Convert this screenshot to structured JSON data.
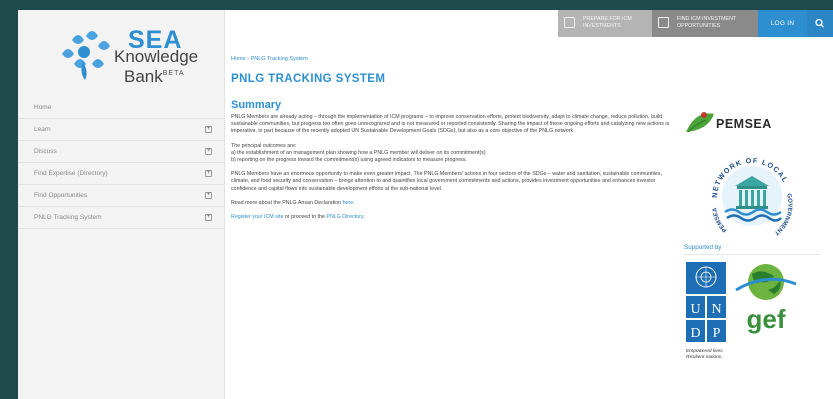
{
  "brand": {
    "sea": "SEA",
    "knowledge": "Knowledge",
    "bank": "Bank",
    "beta": "BETA"
  },
  "topbar": {
    "prepare_label": "PREPARE FOR ICM INVESTMENTS",
    "find_label": "FIND ICM INVESTMENT OPPORTUNITIES",
    "login_label": "LOG IN",
    "search_glyph": "🔍"
  },
  "nav": {
    "items": [
      {
        "label": "Home",
        "expandable": false
      },
      {
        "label": "Learn",
        "expandable": true
      },
      {
        "label": "Discuss",
        "expandable": true
      },
      {
        "label": "Find Expertise (Directory)",
        "expandable": true
      },
      {
        "label": "Find Opportunities",
        "expandable": true
      },
      {
        "label": "PNLG Tracking System",
        "expandable": true
      }
    ]
  },
  "breadcrumb": {
    "home": "Home",
    "separator": "›",
    "current": "PNLG Tracking System"
  },
  "main": {
    "title": "PNLG TRACKING SYSTEM",
    "summary_heading": "Summary",
    "p1": "PNLG Members are already acting – through the implementation of ICM programs – to improve conservation efforts, protect biodiversity, adapt to climate change, reduce pollution, build sustainable communities, but progress too often goes unrecognized and is not measured or reported consistently. Sharing the impact of these ongoing efforts and catalyzing new actions is imperative, in part because of the recently adopted UN Sustainable Development Goals (SDGs), but also as a core objective of the PNLG network.",
    "outcomes_intro": "The principal outcomes are:",
    "outcome_a": "a) the establishment of an management plan showing how a PNLG member will deliver on its commitment(s)",
    "outcome_b": "b) reporting on the progress toward the commitment(s) using agreed indicators to measure progress.",
    "p3": "PNLG Members have an enormous opportunity to make even greater impact. The PNLG Members' actions in four sectors of the SDGs – water and sanitation, sustainable communities, climate, and food security and conservation – brings attention to and quantifies local government commitments and actions, provides investment opportunities and enhances investor confidence and capital flows into sustainable development efforts at the sub-national level.",
    "read_more_prefix": "Read more about the PNLG Ansan Declaration ",
    "read_more_link": "here",
    "read_more_suffix": ".",
    "register_link": "Register your ICM site",
    "register_middle": " or proceed to the ",
    "directory_link": "PNLG Directory",
    "register_suffix": "."
  },
  "right": {
    "pemsea_word": "PEMSEA",
    "seal_text_top": "NETWORK OF LOCAL",
    "seal_text_left": "PEMSEA",
    "seal_text_right": "GOVERNMENTS",
    "supported_by": "Supported by",
    "undp_letters": [
      "U",
      "N",
      "D",
      "P"
    ],
    "undp_tag_1": "Empowered lives.",
    "undp_tag_2": "Resilient nations.",
    "gef_word": "gef"
  },
  "colors": {
    "accent": "#2d8fd0",
    "frame_bg": "#1f4a4c",
    "sidebar_bg": "#f3f3f3",
    "undp_blue": "#1d6eb5",
    "gef_green": "#3a8f3d",
    "pemsea_green": "#4aa43a"
  }
}
